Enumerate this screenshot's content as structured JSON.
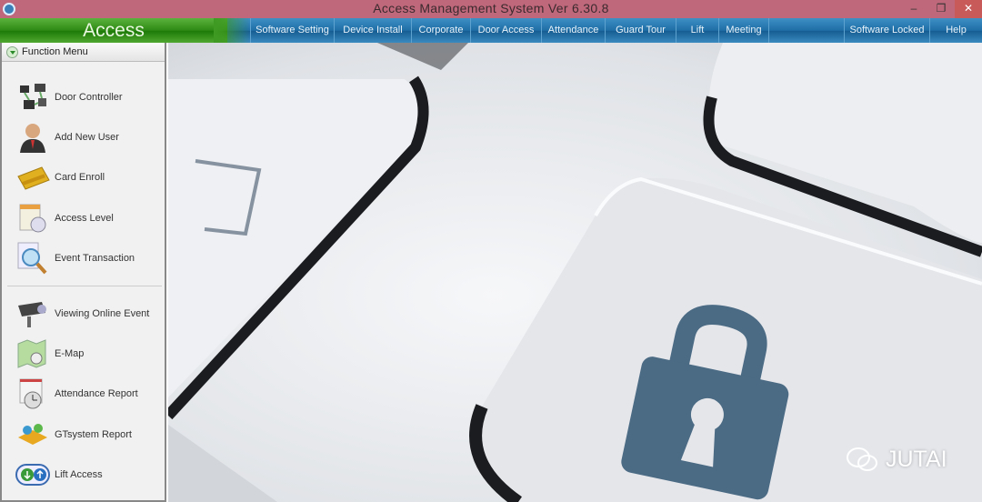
{
  "window": {
    "title": "Access Management System  Ver 6.30.8",
    "minimize": "–",
    "restore": "❐",
    "close": "✕"
  },
  "menubar": {
    "brand": "Access",
    "items": [
      "Software Setting",
      "Device Install",
      "Corporate",
      "Door Access",
      "Attendance",
      "Guard Tour",
      "Lift",
      "Meeting"
    ],
    "right_items": [
      "Software Locked",
      "Help"
    ]
  },
  "sidebar": {
    "header": "Function Menu",
    "items": [
      {
        "label": "Door Controller",
        "icon": "door-controller-icon"
      },
      {
        "label": "Add New User",
        "icon": "user-icon"
      },
      {
        "label": "Card Enroll",
        "icon": "card-icon"
      },
      {
        "label": "Access Level",
        "icon": "access-level-icon"
      },
      {
        "label": "Event Transaction",
        "icon": "magnifier-icon"
      },
      {
        "label": "Viewing Online Event",
        "icon": "camera-icon"
      },
      {
        "label": "E-Map",
        "icon": "map-icon"
      },
      {
        "label": "Attendance Report",
        "icon": "clock-icon"
      },
      {
        "label": "GTsystem Report",
        "icon": "guard-tour-icon"
      },
      {
        "label": "Lift Access",
        "icon": "lift-icon"
      }
    ]
  },
  "watermark": "JUTAI"
}
